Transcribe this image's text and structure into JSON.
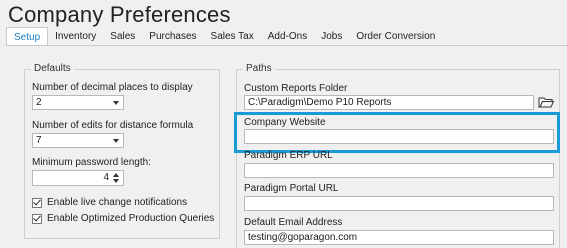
{
  "window": {
    "title": "Company Preferences"
  },
  "tabs": [
    {
      "label": "Setup",
      "active": true
    },
    {
      "label": "Inventory"
    },
    {
      "label": "Sales"
    },
    {
      "label": "Purchases"
    },
    {
      "label": "Sales Tax"
    },
    {
      "label": "Add-Ons"
    },
    {
      "label": "Jobs"
    },
    {
      "label": "Order Conversion"
    }
  ],
  "defaults": {
    "title": "Defaults",
    "decimal_places": {
      "label": "Number of decimal places to display",
      "value": "2"
    },
    "edits_distance": {
      "label": "Number of edits for distance formula",
      "value": "7"
    },
    "min_password": {
      "label": "Minimum password length:",
      "value": "4"
    },
    "live_notifications": {
      "label": "Enable live change notifications",
      "checked": true
    },
    "optimized_queries": {
      "label": "Enable Optimized Production Queries",
      "checked": true
    }
  },
  "paths": {
    "title": "Paths",
    "custom_reports": {
      "label": "Custom Reports Folder",
      "value": "C:\\Paradigm\\Demo P10 Reports"
    },
    "company_website": {
      "label": "Company Website",
      "value": ""
    },
    "erp_url": {
      "label": "Paradigm ERP URL",
      "value": ""
    },
    "portal_url": {
      "label": "Paradigm Portal URL",
      "value": ""
    },
    "default_email": {
      "label": "Default Email Address",
      "value": "testing@goparagon.com"
    }
  },
  "colors": {
    "accent": "#1b7fc3",
    "highlight": "#1a9ad6"
  }
}
